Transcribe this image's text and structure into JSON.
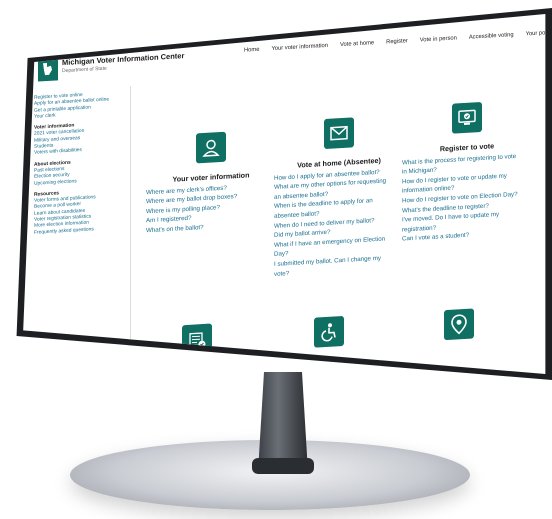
{
  "header": {
    "site_title": "Michigan Voter Information Center",
    "site_subtitle": "Department of State"
  },
  "topnav": [
    "Home",
    "Your voter information",
    "Vote at home",
    "Register",
    "Vote in person",
    "Accessible voting",
    "Your polling place"
  ],
  "sidebar": {
    "top_links": [
      "Register to vote online",
      "Apply for an absentee ballot online",
      "Get a printable application",
      "Your clerk"
    ],
    "groups": [
      {
        "heading": "Voter information",
        "links": [
          "2021 voter cancellation",
          "Military and overseas",
          "Students",
          "Voters with disabilities"
        ]
      },
      {
        "heading": "About elections",
        "links": [
          "Past elections",
          "Election security",
          "Upcoming elections"
        ]
      },
      {
        "heading": "Resources",
        "links": [
          "Voter forms and publications",
          "Become a poll worker",
          "Learn about candidates",
          "Voter registration statistics",
          "More election information",
          "Frequently asked questions"
        ]
      }
    ]
  },
  "columns": [
    {
      "icon": "person-icon",
      "title": "Your voter information",
      "questions": [
        "Where are my clerk's offices?",
        "Where are my ballot drop boxes?",
        "Where is my polling place?",
        "Am I registered?",
        "What's on the ballot?"
      ]
    },
    {
      "icon": "envelope-icon",
      "title": "Vote at home (Absentee)",
      "questions": [
        "How do I apply for an absentee ballot?",
        "What are my other options for requesting",
        "an absentee ballot?",
        "When is the deadline to apply for an",
        "absentee ballot?",
        "When do I need to deliver my ballot?",
        "Did my ballot arrive?",
        "What if I have an emergency on Election",
        "Day?",
        "I submitted my ballot. Can I change my",
        "vote?"
      ]
    },
    {
      "icon": "computer-check-icon",
      "title": "Register to vote",
      "questions": [
        "What is the process for registering to vote",
        "in Michigan?",
        "How do I register to vote or update my",
        "information online?",
        "How do I register to vote on Election Day?",
        "What's the deadline to register?",
        "I've moved. Do I have to update my",
        "registration?",
        "Can I vote as a student?"
      ]
    }
  ],
  "colors": {
    "accent": "#0e6f62",
    "link": "#1a6f8f"
  }
}
